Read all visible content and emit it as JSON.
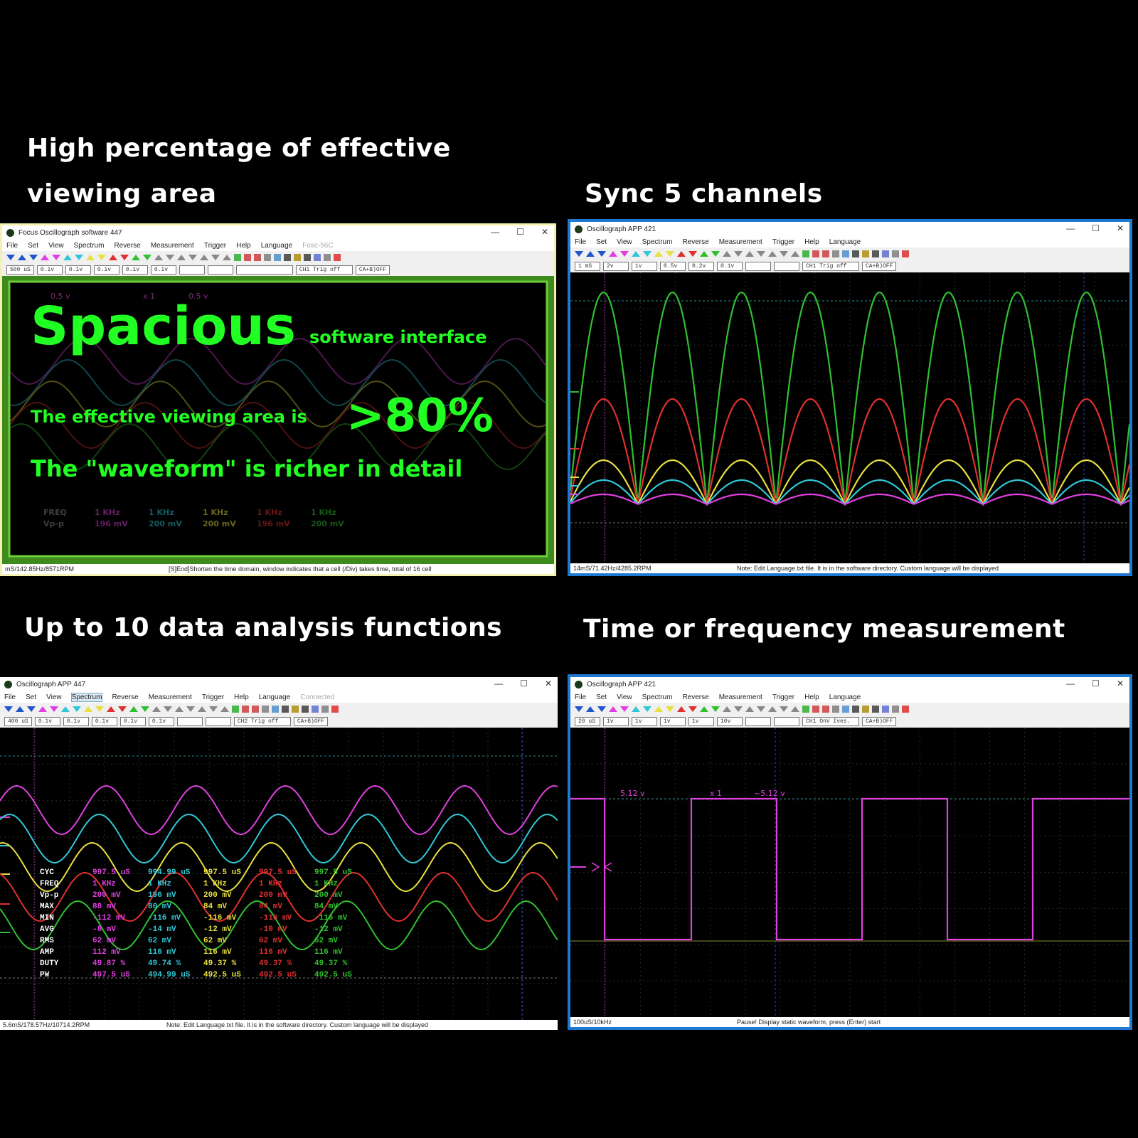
{
  "captions": {
    "top_left_line1": "High percentage of effective",
    "top_left_line2": "viewing area",
    "top_right": "Sync 5 channels",
    "bottom_left": "Up to 10 data analysis functions",
    "bottom_right": "Time or frequency measurement"
  },
  "colors": {
    "background": "#000000",
    "ch1": "#e040e0",
    "ch2": "#30c8d8",
    "ch3": "#e8e040",
    "ch4": "#e03030",
    "ch5": "#30c030",
    "promo_green": "#22ff22",
    "frame_blue": "#1f78d1",
    "frame_green": "#4a9e2a"
  },
  "window_controls": {
    "minimize": "—",
    "maximize": "☐",
    "close": "✕"
  },
  "panel1": {
    "title": "Focus Oscillograph software 447",
    "menu": [
      "File",
      "Set",
      "View",
      "Spectrum",
      "Reverse",
      "Measurement",
      "Trigger",
      "Help",
      "Language"
    ],
    "menu_extra": "Fosc-56C",
    "params": [
      "500 uS",
      "0.1v",
      "0.1v",
      "0.1v",
      "0.1v",
      "0.1v"
    ],
    "trig": "CH1 Trig off",
    "mode": "CA+B)OFF",
    "promo_big": "Spacious",
    "promo_small": "software interface",
    "promo_area_text": "The effective viewing area is",
    "promo_area_value": ">80%",
    "promo_detail": "The \"waveform\" is richer in detail",
    "faint_labels": [
      "FREQ",
      "Vp-p"
    ],
    "faint_freq": [
      "1 KHz",
      "1 KHz",
      "1 KHz",
      "1 KHz",
      "1 KHz"
    ],
    "faint_vpp": [
      "196 mV",
      "200 mV",
      "200 mV",
      "196 mV",
      "200 mV"
    ],
    "faint_top": [
      "0.5 v",
      "x 1",
      "0.5 v"
    ],
    "status_left": "mS/142.85Hz/8571RPM",
    "status_right": "[S]End]Shorten the time domain, window indicates that a cell (/Div) takes time, total of 16 cell"
  },
  "panel2": {
    "title": "Oscillograph APP 421",
    "menu": [
      "File",
      "Set",
      "View",
      "Spectrum",
      "Reverse",
      "Measurement",
      "Trigger",
      "Help",
      "Language"
    ],
    "params": [
      "1 mS",
      "2v",
      "1v",
      "0.5v",
      "0.2v",
      "0.1v"
    ],
    "trig": "CH1 Trig off",
    "mode": "CA+B)OFF",
    "status_left": "14mS/71.42Hz/4285.2RPM",
    "status_right": "Note: Edit Language.txt file. It is in the software directory. Custom language will be displayed"
  },
  "panel3": {
    "title": "Oscillograph APP 447",
    "menu": [
      "File",
      "Set",
      "View",
      "Spectrum",
      "Reverse",
      "Measurement",
      "Trigger",
      "Help",
      "Language"
    ],
    "menu_extra": "Connected",
    "params": [
      "400 uS",
      "0.1v",
      "0.1v",
      "0.1v",
      "0.1v",
      "0.1v"
    ],
    "trig": "CH2 Trig off",
    "mode": "CA+B)OFF",
    "measure_rows": [
      {
        "label": "CYC",
        "values": [
          "997.5 uS",
          "994.99 uS",
          "997.5 uS",
          "997.5 uS",
          "997.5 uS"
        ]
      },
      {
        "label": "FREQ",
        "values": [
          "1 KHz",
          "1 KHz",
          "1 KHz",
          "1 KHz",
          "1 KHz"
        ]
      },
      {
        "label": "Vp-p",
        "values": [
          "200 mV",
          "196 mV",
          "200 mV",
          "200 mV",
          "200 mV"
        ]
      },
      {
        "label": "MAX",
        "values": [
          "88 mV",
          "80 mV",
          "84 mV",
          "84 mV",
          "84 mV"
        ]
      },
      {
        "label": "MIN",
        "values": [
          "-112 mV",
          "-116 mV",
          "-116 mV",
          "-116 mV",
          "-116 mV"
        ]
      },
      {
        "label": "AVG",
        "values": [
          "-8 mV",
          "-14 mV",
          "-12 mV",
          "-10 mV",
          "-12 mV"
        ]
      },
      {
        "label": "RMS",
        "values": [
          "62 mV",
          "62 mV",
          "62 mV",
          "62 mV",
          "62 mV"
        ]
      },
      {
        "label": "AMP",
        "values": [
          "112 mV",
          "116 mV",
          "116 mV",
          "116 mV",
          "116 mV"
        ]
      },
      {
        "label": "DUTY",
        "values": [
          "49.87 %",
          "49.74 %",
          "49.37 %",
          "49.37 %",
          "49.37 %"
        ]
      },
      {
        "label": "PW",
        "values": [
          "497.5 uS",
          "494.99 uS",
          "492.5 uS",
          "492.5 uS",
          "492.5 uS"
        ]
      }
    ],
    "status_left": "5.6mS/178.57Hz/10714.2RPM",
    "status_right": "Note: Edit Language.txt file. It is in the software directory. Custom language will be displayed"
  },
  "panel4": {
    "title": "Oscillograph APP 421",
    "menu": [
      "File",
      "Set",
      "View",
      "Spectrum",
      "Reverse",
      "Measurement",
      "Trigger",
      "Help",
      "Language"
    ],
    "params": [
      "20 uS",
      "1v",
      "1v",
      "1v",
      "1v",
      "10v"
    ],
    "trig": "CH1 OnV Ives.",
    "mode": "CA+B)OFF",
    "marker_left": "5.12 v",
    "marker_mid": "x 1",
    "marker_right": "~5.12 v",
    "status_left": "100uS/10kHz",
    "status_right": "Pause! Display static waveform, press (Enter) start"
  }
}
